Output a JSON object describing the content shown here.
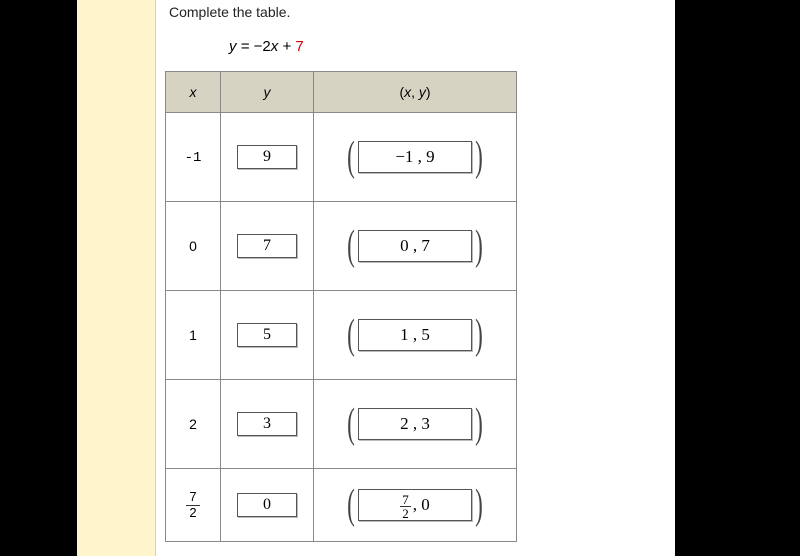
{
  "instruction": "Complete the table.",
  "equation": {
    "lhs": "y",
    "eq": " = ",
    "plus": " + ",
    "constant": "7"
  },
  "headers": {
    "x": "x",
    "y": "y"
  },
  "rows": [
    {
      "x": "-1",
      "y": "9",
      "pair": "−1 , 9"
    },
    {
      "x": "0",
      "y": "7",
      "pair": "0 , 7"
    },
    {
      "x": "1",
      "y": "5",
      "pair": "1 , 5"
    },
    {
      "x": "2",
      "y": "3",
      "pair": "2 , 3"
    },
    {
      "x_num": "7",
      "x_den": "2",
      "y": "0",
      "pair_frac_num": "7",
      "pair_frac_den": "2",
      "pair_rest": ", 0"
    }
  ]
}
